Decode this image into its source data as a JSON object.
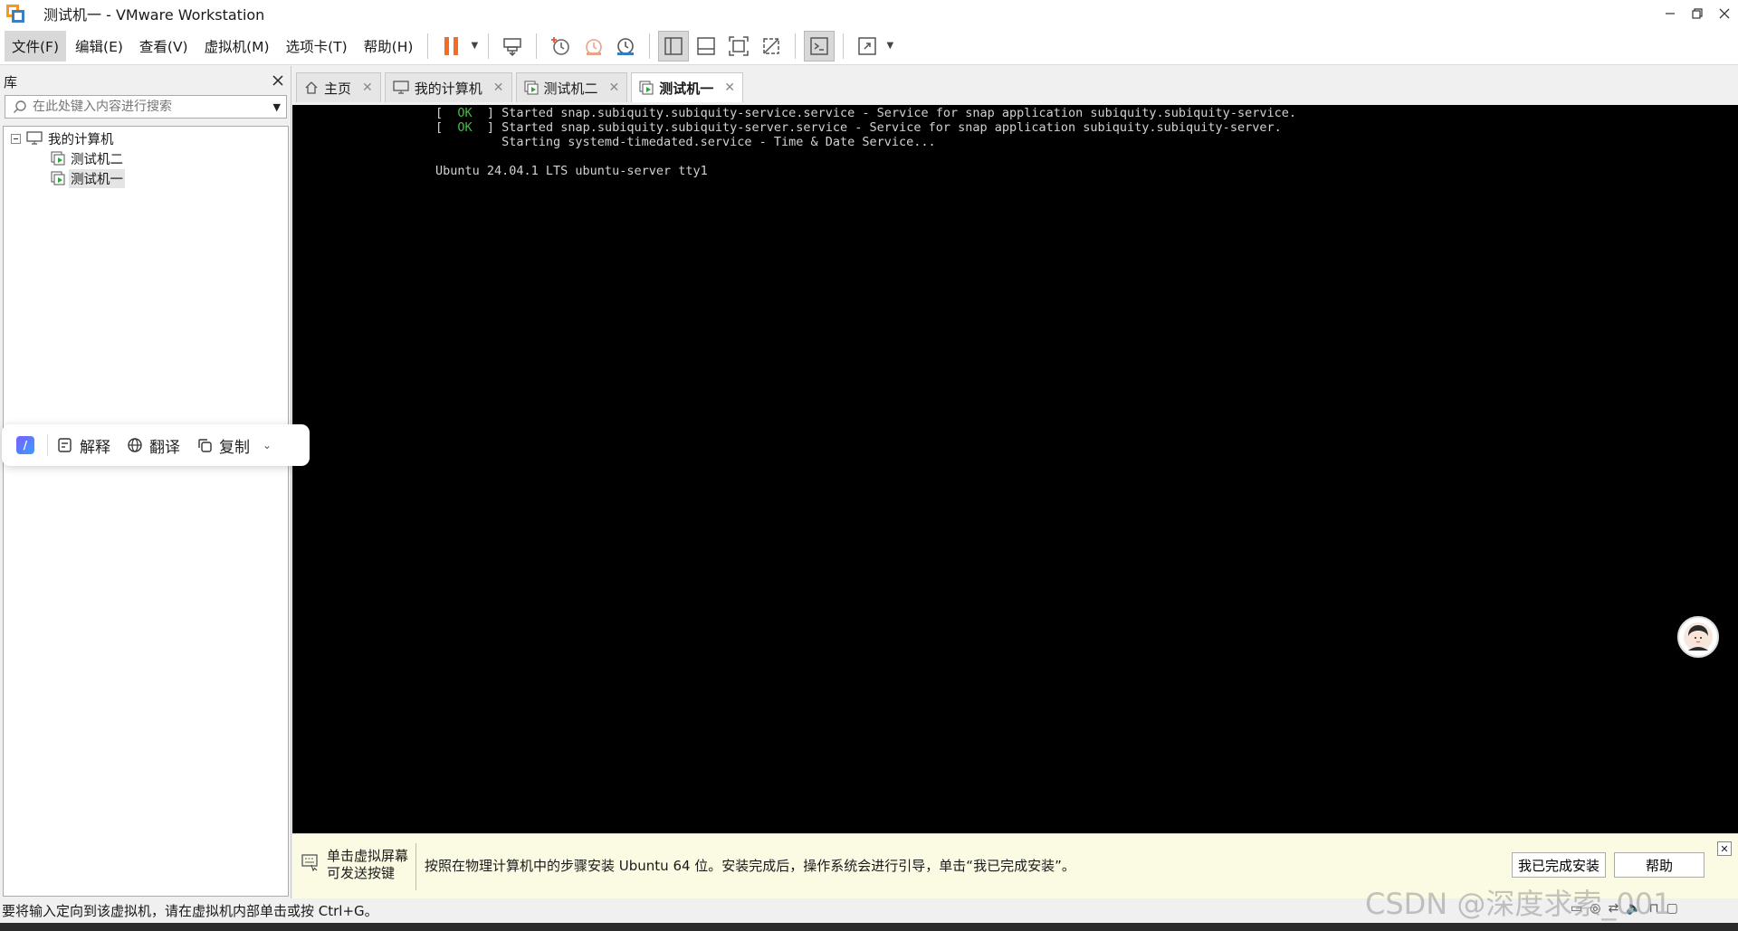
{
  "window": {
    "title": "测试机一 - VMware Workstation",
    "controls": [
      "minimize",
      "restore",
      "close"
    ]
  },
  "menu": [
    "文件(F)",
    "编辑(E)",
    "查看(V)",
    "虚拟机(M)",
    "选项卡(T)",
    "帮助(H)"
  ],
  "toolbar": [
    "pause-icon",
    "send-ctrl-alt-del-icon",
    "snapshot-icon",
    "revert-snapshot-icon",
    "manage-snapshots-icon",
    "show-library-icon",
    "thumbnail-bar-icon",
    "full-screen-icon",
    "unity-icon",
    "console-view-icon",
    "stretch-guest-icon"
  ],
  "library": {
    "title": "库",
    "search_placeholder": "在此处键入内容进行搜索",
    "tree": {
      "root": "我的计算机",
      "children": [
        "测试机二",
        "测试机一"
      ],
      "selected": "测试机一"
    }
  },
  "tabs": [
    {
      "label": "主页",
      "icon": "home-icon",
      "active": false
    },
    {
      "label": "我的计算机",
      "icon": "computer-icon",
      "active": false
    },
    {
      "label": "测试机二",
      "icon": "vm-icon",
      "active": false
    },
    {
      "label": "测试机一",
      "icon": "vm-icon",
      "active": true
    }
  ],
  "console": {
    "lines": [
      {
        "open": "[  ",
        "ok": "OK",
        "close": "  ] ",
        "text": "Started snap.subiquity.subiquity-service.service - Service for snap application subiquity.subiquity-service."
      },
      {
        "open": "[  ",
        "ok": "OK",
        "close": "  ] ",
        "text": "Started snap.subiquity.subiquity-server.service - Service for snap application subiquity.subiquity-server."
      },
      {
        "open": "",
        "ok": "",
        "close": "",
        "text": "         Starting systemd-timedated.service - Time & Date Service..."
      },
      {
        "open": "",
        "ok": "",
        "close": "",
        "text": ""
      },
      {
        "open": "",
        "ok": "",
        "close": "",
        "text": "Ubuntu 24.04.1 LTS ubuntu-server tty1"
      }
    ]
  },
  "infobar": {
    "hint_line1": "单击虚拟屏幕",
    "hint_line2": "可发送按键",
    "message": "按照在物理计算机中的步骤安装 Ubuntu 64 位。安装完成后，操作系统会进行引导，单击“我已完成安装”。",
    "done_button": "我已完成安装",
    "help_button": "帮助"
  },
  "status": "要将输入定向到该虚拟机，请在虚拟机内部单击或按 Ctrl+G。",
  "float_bar": {
    "explain": "解释",
    "translate": "翻译",
    "copy": "复制"
  },
  "watermark": "CSDN @深度求索_001",
  "colors": {
    "accent_orange": "#f36c21",
    "console_bg": "#000000",
    "ok_green": "#3fbf3f",
    "infobar_bg": "#fbfbe4"
  }
}
